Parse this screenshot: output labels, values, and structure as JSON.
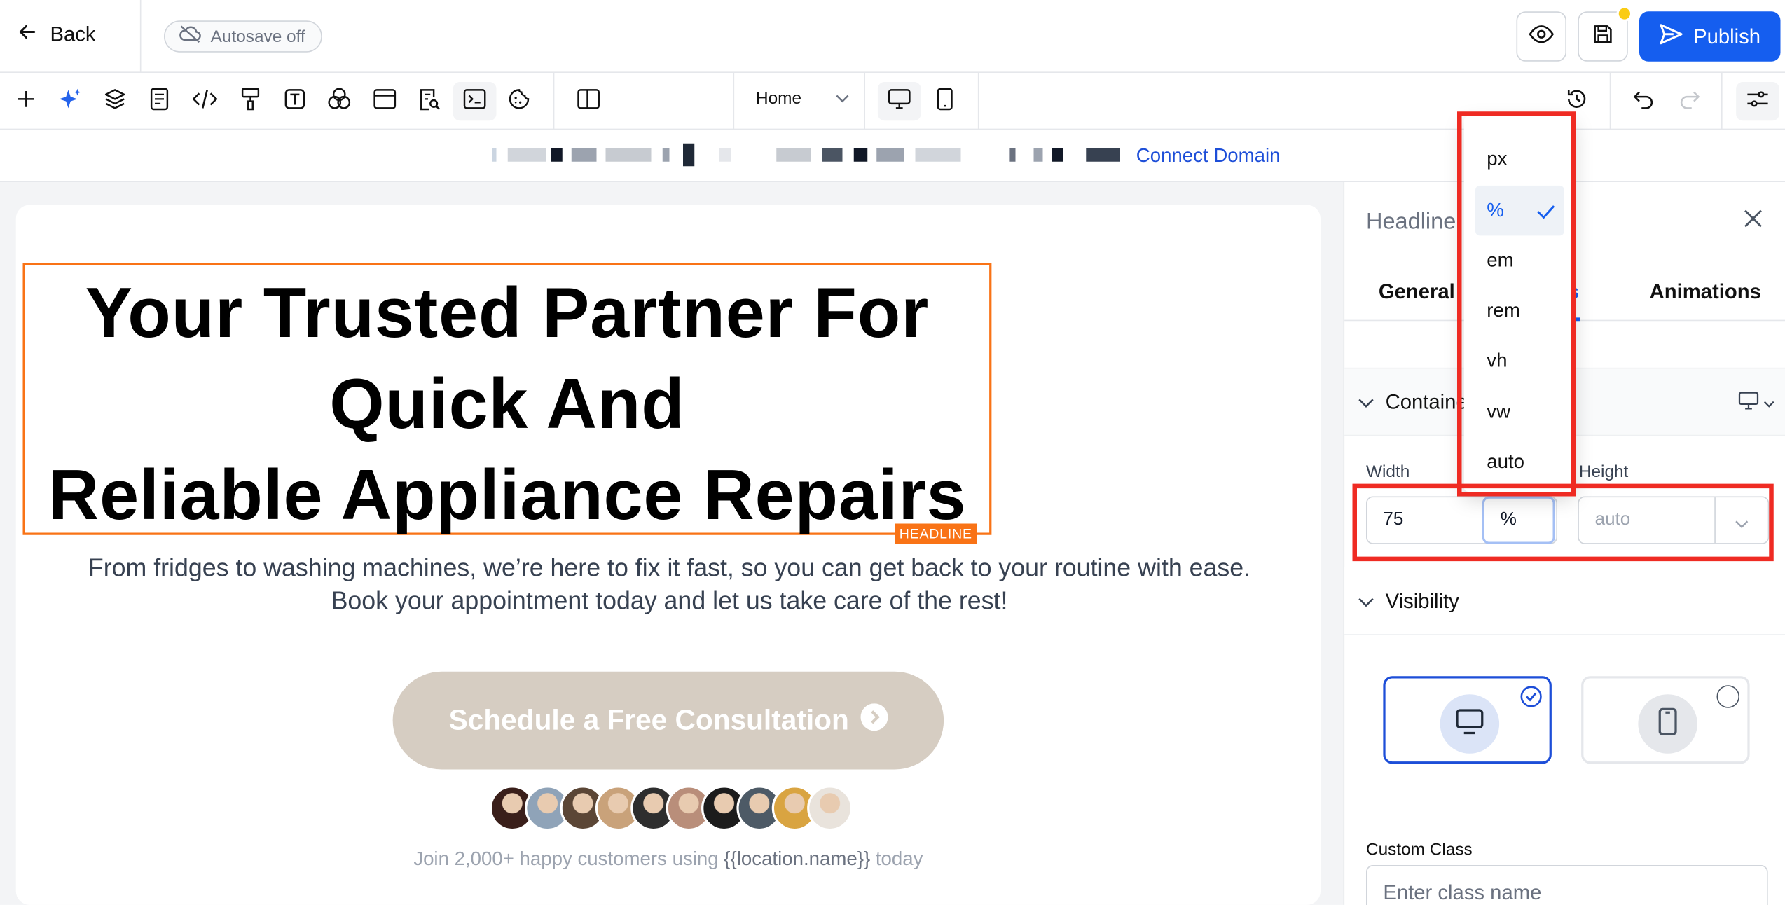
{
  "topbar": {
    "back_label": "Back",
    "autosave_label": "Autosave off",
    "publish_label": "Publish"
  },
  "toolbar": {
    "page_select_value": "Home"
  },
  "domain_bar": {
    "connect_label": "Connect Domain"
  },
  "canvas": {
    "headline_lines": [
      "Your Trusted Partner For",
      "Quick And",
      "Reliable Appliance Repairs"
    ],
    "headline_tag": "HEADLINE",
    "subtext_line1": "From fridges to washing machines, we’re here to fix it fast, so you can get back to your routine with ease.",
    "subtext_line2": "Book your appointment today and let us take care of the rest!",
    "cta_label": "Schedule a Free Consultation",
    "join_prefix": "Join 2,000+ happy customers using ",
    "join_variable": "{{location.name}}",
    "join_suffix": " today",
    "avatar_colors": [
      "#3a1f1a",
      "#8fa3b8",
      "#5b4636",
      "#c9a27a",
      "#2e2e2e",
      "#b98e7a",
      "#1c1c1c",
      "#4d5a66",
      "#d9a441",
      "#e9e3dc"
    ]
  },
  "panel": {
    "title": "Headline",
    "tabs": [
      "General",
      "s",
      "Animations"
    ],
    "section_container": "Containe",
    "width_label": "Width",
    "width_value": "75",
    "unit_value": "%",
    "height_label": "Height",
    "height_placeholder": "auto",
    "section_visibility": "Visibility",
    "custom_class_label": "Custom Class",
    "custom_class_placeholder": "Enter class name"
  },
  "unit_dropdown": {
    "options": [
      "px",
      "%",
      "em",
      "rem",
      "vh",
      "vw",
      "auto"
    ],
    "selected": "%"
  },
  "colors": {
    "accent": "#155eef",
    "selection_outline": "#f97316",
    "annotation_red": "#ef2b23",
    "cta_bg": "#d6cdc2"
  }
}
